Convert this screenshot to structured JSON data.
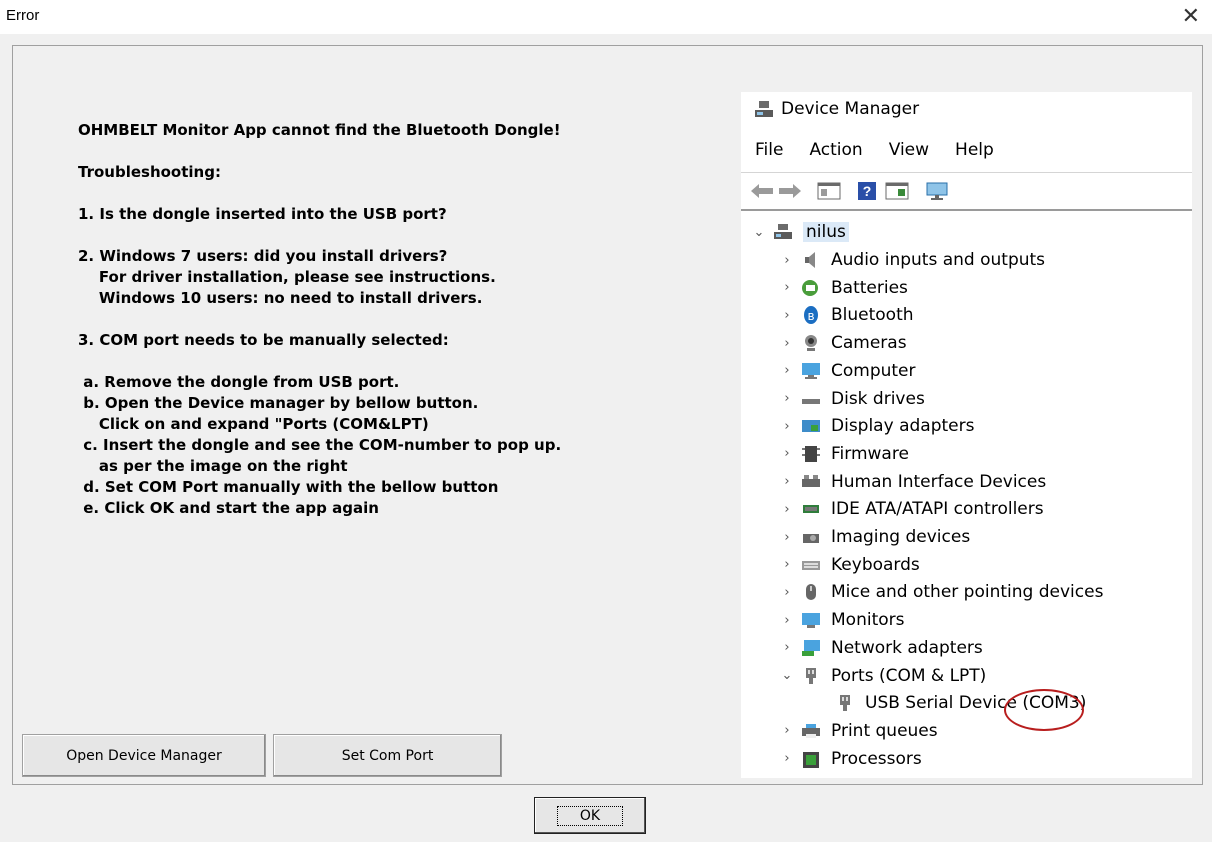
{
  "window": {
    "title": "Error",
    "close_glyph": "✕"
  },
  "instructions": [
    "OHMBELT Monitor App cannot find the Bluetooth Dongle!",
    "",
    "Troubleshooting:",
    "",
    "1. Is the dongle inserted into the USB port?",
    "",
    "2. Windows 7 users: did you install drivers?",
    "    For driver installation, please see instructions.",
    "    Windows 10 users: no need to install drivers.",
    "",
    "3. COM port needs to be manually selected:",
    "",
    " a. Remove the dongle from USB port.",
    " b. Open the Device manager by bellow button.",
    "    Click on and expand \"Ports (COM&LPT)",
    " c. Insert the dongle and see the COM-number to pop up.",
    "    as per the image on the right",
    " d. Set COM Port manually with the bellow button",
    " e. Click OK and start the app again"
  ],
  "buttons": {
    "open_device_manager": "Open Device Manager",
    "set_com_port": "Set Com Port",
    "ok": "OK"
  },
  "device_manager": {
    "title": "Device Manager",
    "menu": [
      "File",
      "Action",
      "View",
      "Help"
    ],
    "root": "nilus",
    "items": [
      {
        "label": "Audio inputs and outputs",
        "icon": "speaker-icon"
      },
      {
        "label": "Batteries",
        "icon": "battery-icon"
      },
      {
        "label": "Bluetooth",
        "icon": "bluetooth-icon"
      },
      {
        "label": "Cameras",
        "icon": "camera-icon"
      },
      {
        "label": "Computer",
        "icon": "computer-icon"
      },
      {
        "label": "Disk drives",
        "icon": "disk-drive-icon"
      },
      {
        "label": "Display adapters",
        "icon": "display-adapter-icon"
      },
      {
        "label": "Firmware",
        "icon": "firmware-icon"
      },
      {
        "label": "Human Interface Devices",
        "icon": "hid-icon"
      },
      {
        "label": "IDE ATA/ATAPI controllers",
        "icon": "ide-controller-icon"
      },
      {
        "label": "Imaging devices",
        "icon": "imaging-device-icon"
      },
      {
        "label": "Keyboards",
        "icon": "keyboard-icon"
      },
      {
        "label": "Mice and other pointing devices",
        "icon": "mouse-icon"
      },
      {
        "label": "Monitors",
        "icon": "monitor-icon"
      },
      {
        "label": "Network adapters",
        "icon": "network-adapter-icon"
      },
      {
        "label": "Ports (COM & LPT)",
        "icon": "port-icon",
        "expanded": true
      },
      {
        "label": "USB Serial Device (COM3)",
        "icon": "port-icon",
        "child": true
      },
      {
        "label": "Print queues",
        "icon": "printer-icon"
      },
      {
        "label": "Processors",
        "icon": "processor-icon"
      }
    ],
    "highlight_color": "#b81e1e"
  }
}
